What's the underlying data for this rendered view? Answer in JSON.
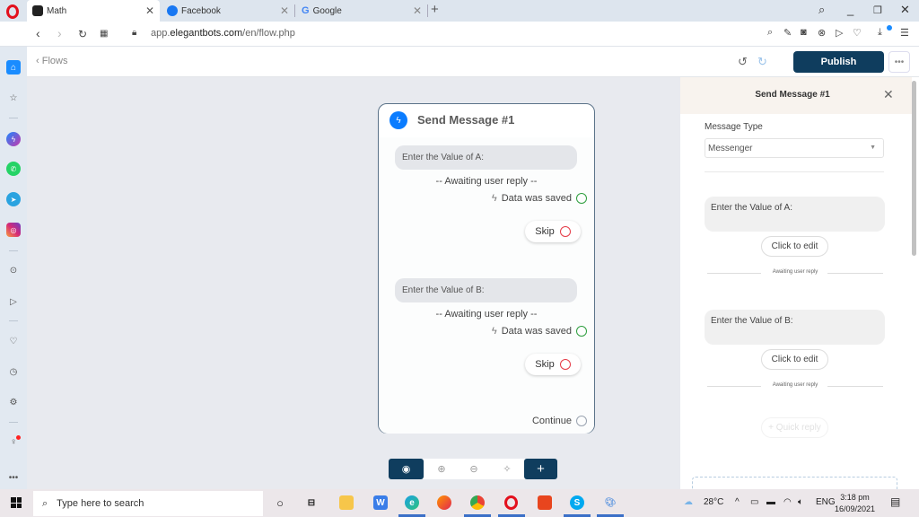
{
  "browser": {
    "tabs": [
      {
        "label": "Math",
        "icon": "elegantbots-icon",
        "active": true
      },
      {
        "label": "Facebook",
        "icon": "facebook-icon",
        "active": false
      },
      {
        "label": "Google",
        "icon": "google-icon",
        "active": false
      }
    ],
    "new_tab": "+",
    "url_prefix": "app.",
    "url_domain": "elegantbots.com",
    "url_path": "/en/flow.php",
    "window_controls": [
      "search-icon",
      "minimize-icon",
      "restore-icon",
      "close-icon"
    ],
    "toolbar_icons": [
      "zoom-out-icon",
      "snapshot-edit-icon",
      "camera-icon",
      "adblock-icon",
      "send-icon",
      "heart-icon",
      "download-icon",
      "easy-setup-icon"
    ]
  },
  "opera_sidebar": {
    "items": [
      "home-icon",
      "star-icon",
      "messenger-icon",
      "whatsapp-icon",
      "telegram-icon",
      "instagram-icon",
      "player-icon",
      "flow-send-icon",
      "heart-icon",
      "history-icon",
      "settings-icon",
      "lightbulb-icon",
      "more-icon"
    ]
  },
  "app_header": {
    "back_label": "Flows",
    "publish_label": "Publish",
    "more_label": "•••"
  },
  "node": {
    "title": "Send Message #1",
    "blocks": [
      {
        "prompt": "Enter the Value of A:",
        "awaiting": "-- Awaiting user reply --",
        "saved": "Data was saved",
        "skip": "Skip"
      },
      {
        "prompt": "Enter the Value of B:",
        "awaiting": "-- Awaiting user reply --",
        "saved": "Data was saved",
        "skip": "Skip"
      }
    ],
    "continue": "Continue"
  },
  "canvas_toolbar": {
    "add_label": "+"
  },
  "right_panel": {
    "title": "Send Message #1",
    "message_type_label": "Message Type",
    "message_type_value": "Messenger",
    "blocks": [
      {
        "prompt": "Enter the Value of A:",
        "edit": "Click to edit",
        "awaiting": "Awaiting user reply"
      },
      {
        "prompt": "Enter the Value of B:",
        "edit": "Click to edit",
        "awaiting": "Awaiting user reply"
      }
    ],
    "quick_reply": "+ Quick reply"
  },
  "taskbar": {
    "search_placeholder": "Type here to search",
    "weather": "28°C",
    "language": "ENG",
    "time": "3:18 pm",
    "date": "16/09/2021"
  },
  "colors": {
    "accent": "#0f3d5e",
    "saved_ring": "#2e9e3e",
    "skip_ring": "#e53945",
    "continue_ring": "#9aa3b0"
  }
}
